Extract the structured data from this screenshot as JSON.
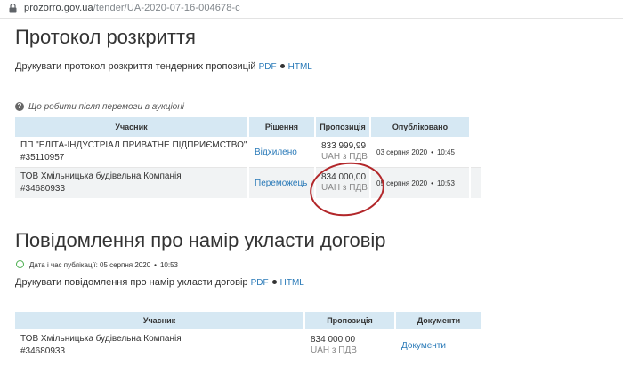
{
  "browser": {
    "url_host": "prozorro.gov.ua",
    "url_path": "/tender/UA-2020-07-16-004678-c"
  },
  "section1": {
    "title": "Протокол розкриття",
    "print_text": "Друкувати протокол розкриття тендерних пропозицій",
    "pdf": "PDF",
    "html": "HTML",
    "hint": "Що робити після перемоги в аукціоні",
    "columns": [
      "Учасник",
      "Рішення",
      "Пропозиція",
      "Опубліковано"
    ],
    "rows": [
      {
        "name_line1": "ПП \"ЕЛІТА-ІНДУСТРІАЛ ПРИВАТНЕ ПІДПРИЄМСТВО\"",
        "name_line2": "#35110957",
        "decision": "Відхилено",
        "amount": "833 999,99",
        "vat": "UAH з ПДВ",
        "published_date": "03 серпня 2020",
        "published_time": "10:45"
      },
      {
        "name_line1": "ТОВ Хмільницька будівельна Компанія",
        "name_line2": "#34680933",
        "decision": "Переможець",
        "amount": "834 000,00",
        "vat": "UAH з ПДВ",
        "published_date": "05 серпня 2020",
        "published_time": "10:53"
      }
    ]
  },
  "section2": {
    "title": "Повідомлення про намір укласти договір",
    "pub_label": "Дата і час публікації: 05 серпня 2020",
    "pub_time": "10:53",
    "print_text": "Друкувати повідомлення про намір укласти договір",
    "pdf": "PDF",
    "html": "HTML",
    "columns": [
      "Учасник",
      "Пропозиція",
      "Документи"
    ],
    "row": {
      "name_line1": "ТОВ Хмільницька будівельна Компанія",
      "name_line2": "#34680933",
      "amount": "834 000,00",
      "vat": "UAH з ПДВ",
      "documents": "Документи"
    }
  },
  "colors": {
    "header_bg": "#d6e8f3",
    "link": "#2a7ab8",
    "highlight_circle": "#b2272a",
    "clock": "#4caf50"
  }
}
